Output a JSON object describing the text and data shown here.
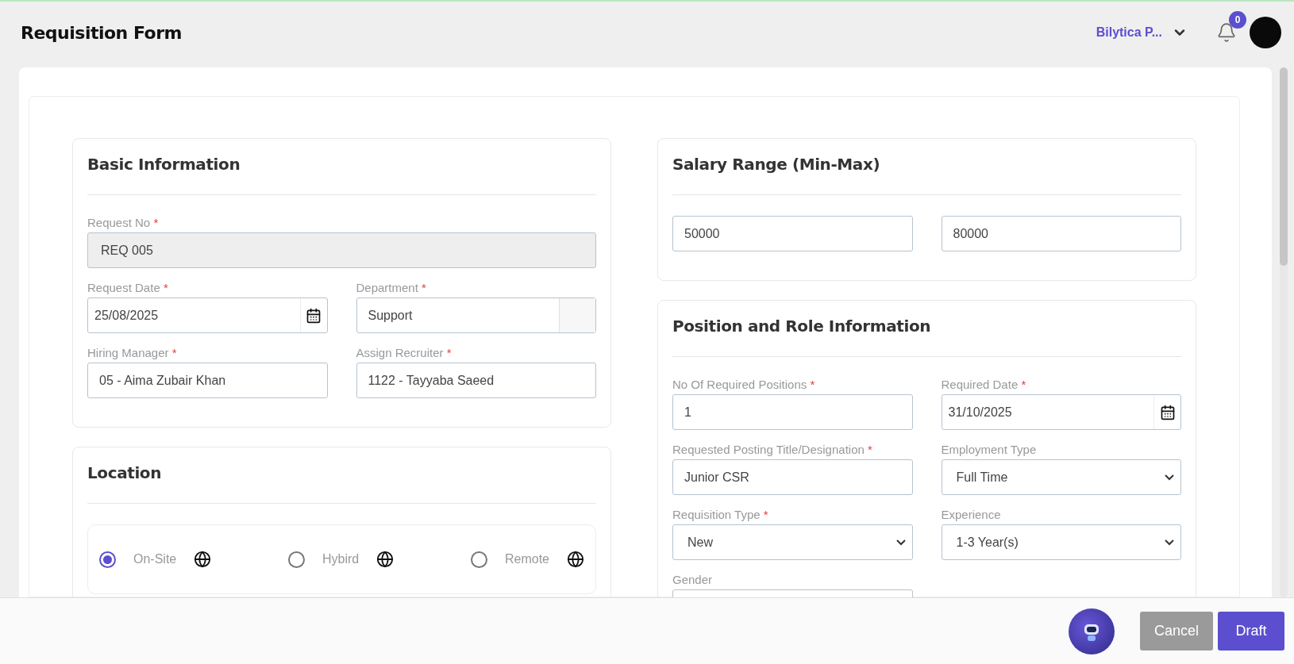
{
  "header": {
    "title": "Requisition Form",
    "company": "Bilytica P...",
    "notification_count": "0"
  },
  "left_sections": [
    {
      "kind": "fields",
      "title": "Basic Information",
      "rows": [
        [
          {
            "label": "Request No",
            "mark": "*",
            "value": "REQ 005",
            "kind": "readonly"
          }
        ],
        [
          {
            "label": "Request Date",
            "mark": "*",
            "value": "25/08/2025",
            "kind": "date"
          },
          {
            "label": "Department",
            "mark": "*",
            "value": "Support",
            "kind": "addon"
          }
        ],
        [
          {
            "label": "Hiring Manager",
            "mark": "*",
            "value": "05 - Aima Zubair Khan",
            "kind": "text"
          },
          {
            "label": "Assign Recruiter",
            "mark": "*",
            "value": "1122 - Tayyaba Saeed",
            "kind": "text"
          }
        ]
      ]
    },
    {
      "kind": "radios",
      "title": "Location",
      "options": [
        {
          "label": "On-Site",
          "selected": true
        },
        {
          "label": "Hybird",
          "selected": false
        },
        {
          "label": "Remote",
          "selected": false
        }
      ]
    }
  ],
  "right_sections": [
    {
      "kind": "fields",
      "title": "Salary Range (Min-Max)",
      "rows": [
        [
          {
            "value": "50000",
            "kind": "text"
          },
          {
            "value": "80000",
            "kind": "text"
          }
        ]
      ]
    },
    {
      "kind": "fields",
      "title": "Position and Role Information",
      "rows": [
        [
          {
            "label": "No Of Required Positions",
            "mark": "*",
            "value": "1",
            "kind": "text"
          },
          {
            "label": "Required Date",
            "mark": "*",
            "value": "31/10/2025",
            "kind": "date"
          }
        ],
        [
          {
            "label": "Requested Posting Title/Designation",
            "mark": "*",
            "value": "Junior CSR",
            "kind": "text"
          },
          {
            "label": "Employment Type",
            "value": "Full Time",
            "kind": "select"
          }
        ],
        [
          {
            "label": "Requisition Type",
            "mark": "*",
            "value": "New",
            "kind": "select"
          },
          {
            "label": "Experience",
            "value": "1-3 Year(s)",
            "kind": "select"
          }
        ],
        [
          {
            "label": "Gender",
            "kind": "select"
          }
        ]
      ]
    }
  ],
  "footer": {
    "buttons": [
      {
        "label": "Cancel",
        "kind": "secondary"
      },
      {
        "label": "Draft",
        "kind": "primary"
      }
    ]
  }
}
